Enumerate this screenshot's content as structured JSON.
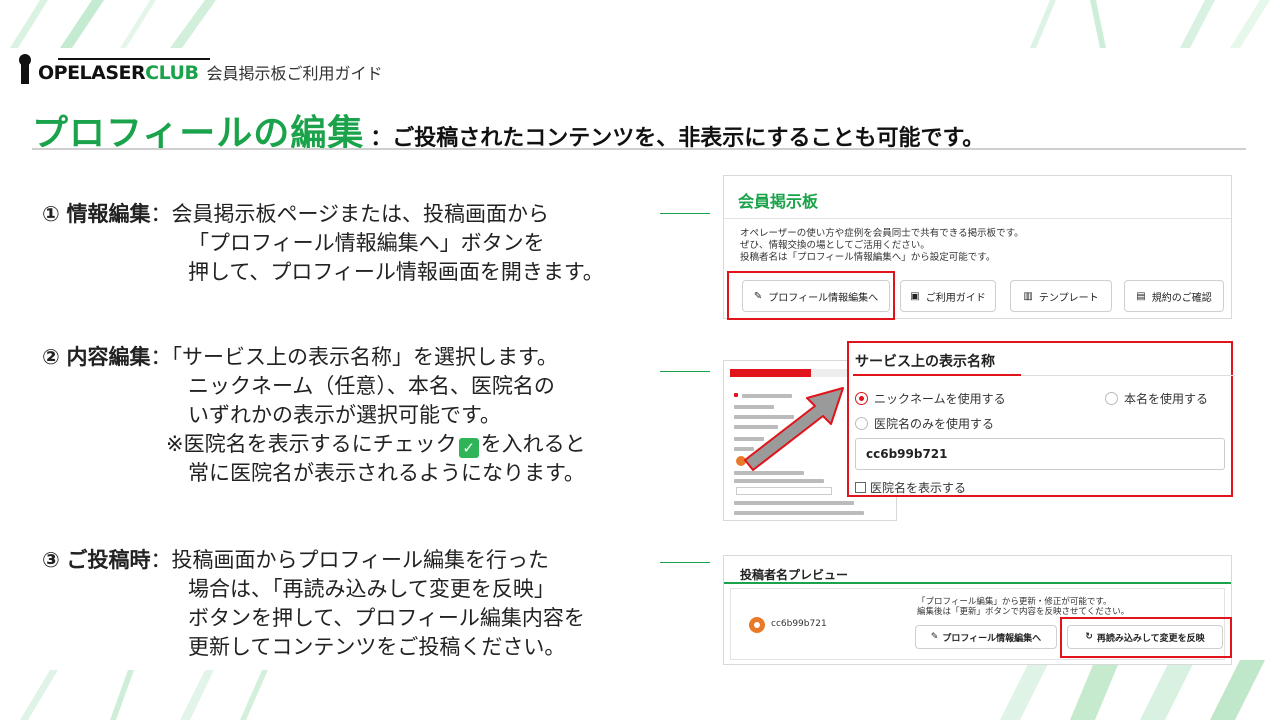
{
  "brand": {
    "logo_main": "OPELASER",
    "logo_club": "CLUB",
    "subtitle": "会員掲示板ご利用ガイド"
  },
  "title": {
    "main": "プロフィールの編集",
    "sub": "：ご投稿されたコンテンツを、非表示にすることも可能です。"
  },
  "steps": [
    {
      "num": "①",
      "head": "情報編集",
      "lines": [
        "：会員掲示板ページまたは、投稿画面から",
        "「プロフィール情報編集へ」ボタンを",
        "押して、プロフィール情報画面を開きます。"
      ]
    },
    {
      "num": "②",
      "head": "内容編集",
      "lines": [
        "：「サービス上の表示名称」を選択します。",
        "ニックネーム（任意）、本名、医院名の",
        "いずれかの表示が選択可能です。",
        "※医院名を表示するにチェック",
        "を入れると",
        "常に医院名が表示されるようになります。"
      ]
    },
    {
      "num": "③",
      "head": "ご投稿時",
      "lines": [
        "：投稿画面からプロフィール編集を行った",
        "場合は、「再読み込みして変更を反映」",
        "ボタンを押して、プロフィール編集内容を",
        "更新してコンテンツをご投稿ください。"
      ]
    }
  ],
  "panel1": {
    "title": "会員掲示板",
    "desc": [
      "オペレーザーの使い方や症例を会員同士で共有できる掲示板です。",
      "ぜひ、情報交換の場としてご活用ください。",
      "投稿者名は「プロフィール情報編集へ」から設定可能です。"
    ],
    "buttons": [
      "プロフィール情報編集へ",
      "ご利用ガイド",
      "テンプレート",
      "規約のご確認"
    ]
  },
  "panel2": {
    "title": "サービス上の表示名称",
    "options": [
      "ニックネームを使用する",
      "本名を使用する",
      "医院名のみを使用する"
    ],
    "selected": "ニックネームを使用する",
    "input_value": "cc6b99b721",
    "checkbox_label": "医院名を表示する"
  },
  "panel3": {
    "title": "投稿者名プレビュー",
    "name": "cc6b99b721",
    "desc": [
      "「プロフィール編集」から更新・修正が可能です。",
      "編集後は「更新」ボタンで内容を反映させてください。"
    ],
    "btn_edit": "プロフィール情報編集へ",
    "btn_reload": "再読み込みして変更を反映"
  },
  "colors": {
    "accent": "#1aa34a",
    "highlight": "#e0141a"
  }
}
